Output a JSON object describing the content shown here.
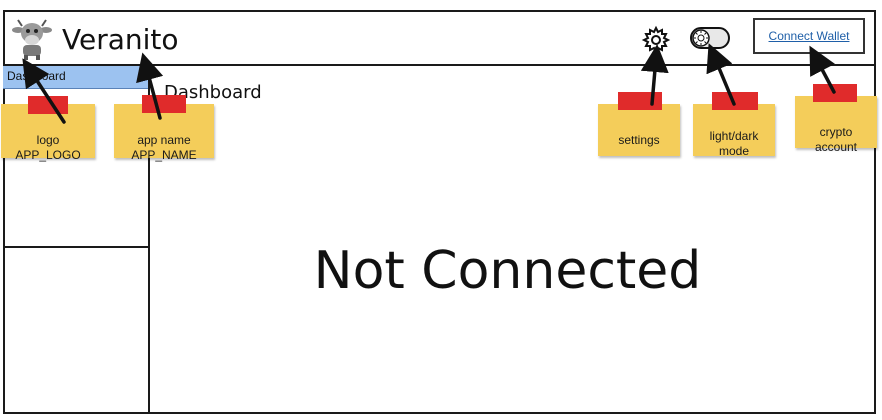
{
  "app": {
    "name": "Veranito"
  },
  "header": {
    "connect_wallet_label": "Connect Wallet"
  },
  "sidebar": {
    "items": [
      {
        "label": "Dashboard",
        "active": true
      }
    ]
  },
  "main": {
    "title": "Dashboard",
    "status_text": "Not Connected"
  },
  "annotations": [
    {
      "id": "logo",
      "text": "logo\nAPP_LOGO"
    },
    {
      "id": "app_name",
      "text": "app name\nAPP_NAME"
    },
    {
      "id": "settings",
      "text": "settings"
    },
    {
      "id": "theme",
      "text": "light/dark\nmode"
    },
    {
      "id": "account",
      "text": "crypto\naccount"
    }
  ],
  "colors": {
    "active_item": "#9cc2f0",
    "note": "#f4cd5a",
    "tape": "#e02b2b",
    "link": "#1f5fa8"
  },
  "icons": {
    "logo": "cow-logo-icon",
    "settings": "gear-icon",
    "theme": "toggle-icon"
  }
}
